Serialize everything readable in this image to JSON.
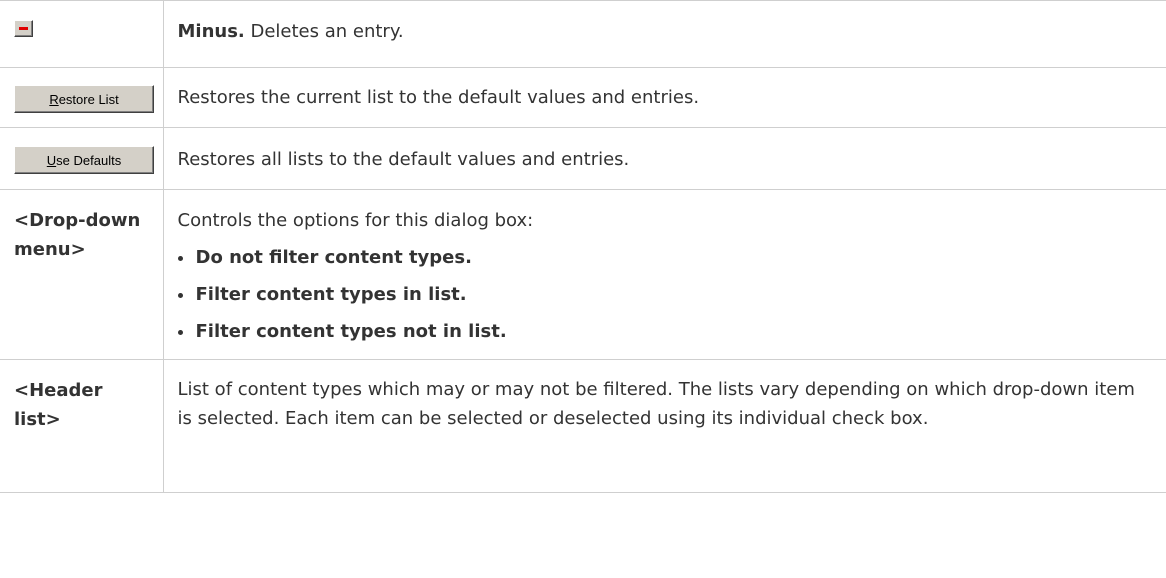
{
  "rows": [
    {
      "ui": {
        "type": "icon-button",
        "icon": "minus-icon"
      },
      "desc_bold": "Minus.",
      "desc_text": " Deletes an entry."
    },
    {
      "ui": {
        "type": "button",
        "label_accel": "R",
        "label_rest": "estore List"
      },
      "desc_text": "Restores the current list to the default values and entries."
    },
    {
      "ui": {
        "type": "button",
        "label_accel": "U",
        "label_rest": "se Defaults"
      },
      "desc_text": "Restores all lists to the default values and entries."
    },
    {
      "ui": {
        "type": "label",
        "label": "<Drop-down menu>"
      },
      "desc_text": "Controls the options for this dialog box:",
      "options": [
        "Do not filter content types.",
        "Filter content types in list.",
        "Filter content types not in list."
      ]
    },
    {
      "ui": {
        "type": "label",
        "label": "<Header list>"
      },
      "desc_text": "List of content types which may or may not be filtered. The lists vary depending on which drop-down item is selected. Each item can be selected or deselected using its individual check box."
    }
  ],
  "colors": {
    "text": "#333333",
    "border": "#cfcfcf",
    "button_face": "#d4d0c8",
    "minus_red": "#e00000"
  }
}
